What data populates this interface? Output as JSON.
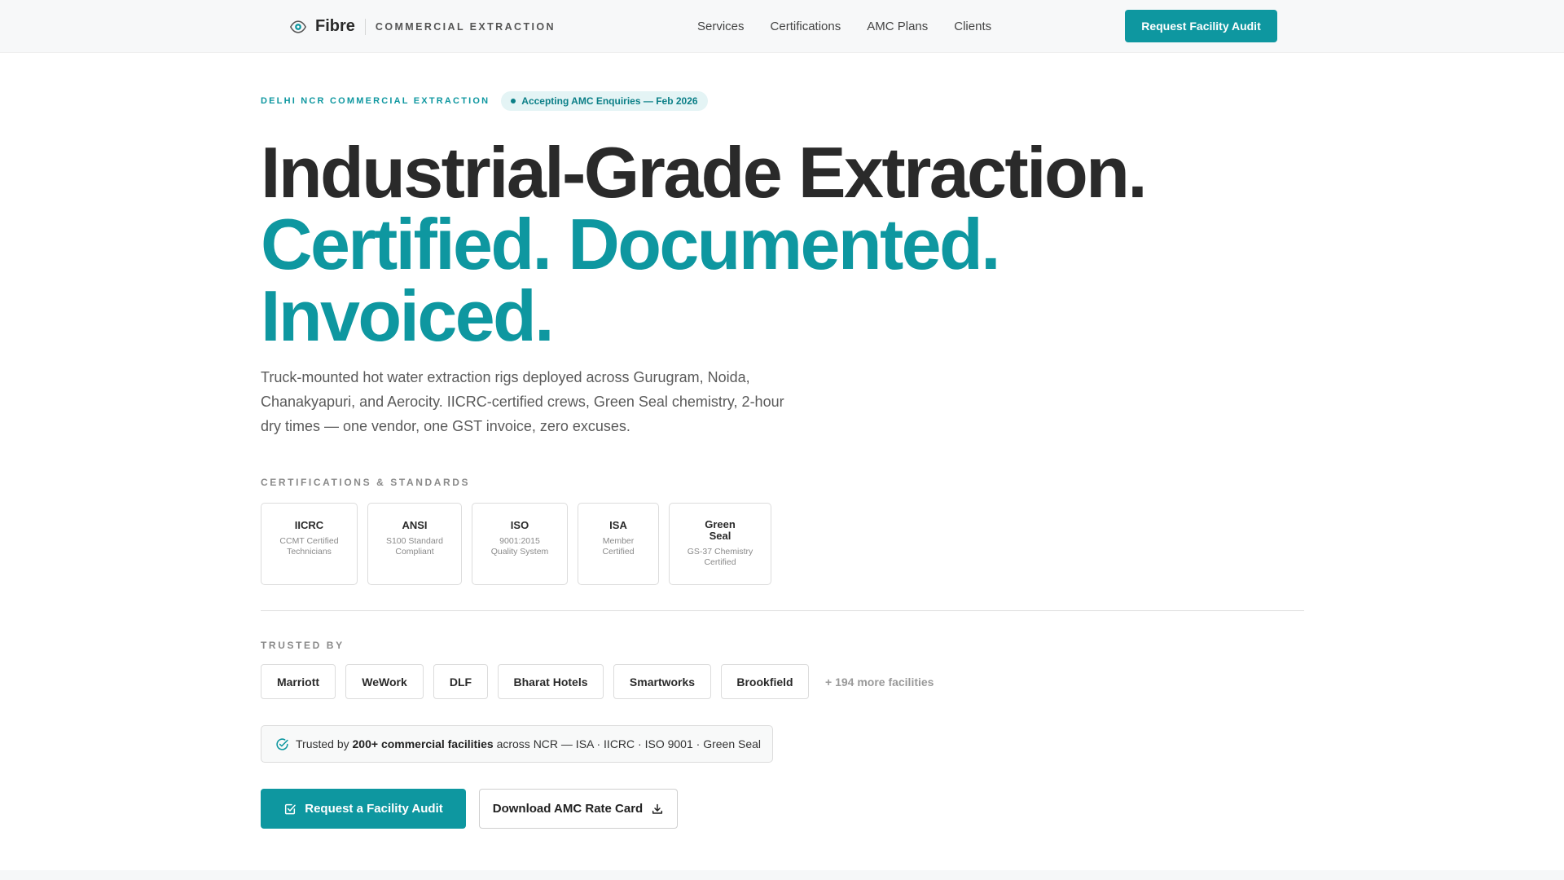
{
  "nav": {
    "brand_name": "Fibre",
    "brand_tagline": "COMMERCIAL EXTRACTION",
    "links": [
      "Services",
      "Certifications",
      "AMC Plans",
      "Clients"
    ],
    "cta": "Request Facility Audit"
  },
  "hero": {
    "eyebrow": "DELHI NCR COMMERCIAL EXTRACTION",
    "status_pill": "Accepting AMC Enquiries — Feb 2026",
    "headline_lines": [
      "Industrial-Grade Extraction.",
      "Certified. Documented.",
      "Invoiced."
    ],
    "lede": "Truck-mounted hot water extraction rigs deployed across Gurugram, Noida, Chanakyapuri, and Aerocity. IICRC-certified crews, Green Seal chemistry, 2-hour dry times — one vendor, one GST invoice, zero excuses."
  },
  "certifications": {
    "label": "CERTIFICATIONS & STANDARDS",
    "items": [
      {
        "title": "IICRC",
        "sub_lines": [
          "CCMT Certified",
          "Technicians"
        ]
      },
      {
        "title": "ANSI",
        "sub_lines": [
          "S100 Standard",
          "Compliant"
        ]
      },
      {
        "title": "ISO",
        "sub_lines": [
          "9001:2015",
          "Quality System"
        ]
      },
      {
        "title": "ISA",
        "sub_lines": [
          "Member",
          "Certified"
        ]
      },
      {
        "title": "Green Seal",
        "sub_lines": [
          "GS-37 Chemistry",
          "Certified"
        ]
      }
    ]
  },
  "trusted": {
    "label": "TRUSTED BY",
    "clients": [
      "Marriott",
      "WeWork",
      "DLF",
      "Bharat Hotels",
      "Smartworks",
      "Brookfield"
    ],
    "more": "+ 194 more facilities"
  },
  "trust_banner": {
    "prefix": "Trusted by ",
    "bold": "200+ commercial facilities",
    "suffix": " across NCR — ISA · IICRC · ISO 9001 · Green Seal"
  },
  "ctas": {
    "primary": "Request a Facility Audit",
    "secondary": "Download AMC Rate Card"
  },
  "colors": {
    "accent": "#0e97a0",
    "heading": "#2a2a2a",
    "body": "#5a5a5a"
  },
  "icons": {
    "brand": "eye-icon",
    "trust": "check-circle-icon",
    "primary_cta": "checkbox-icon",
    "secondary_cta": "download-icon"
  }
}
